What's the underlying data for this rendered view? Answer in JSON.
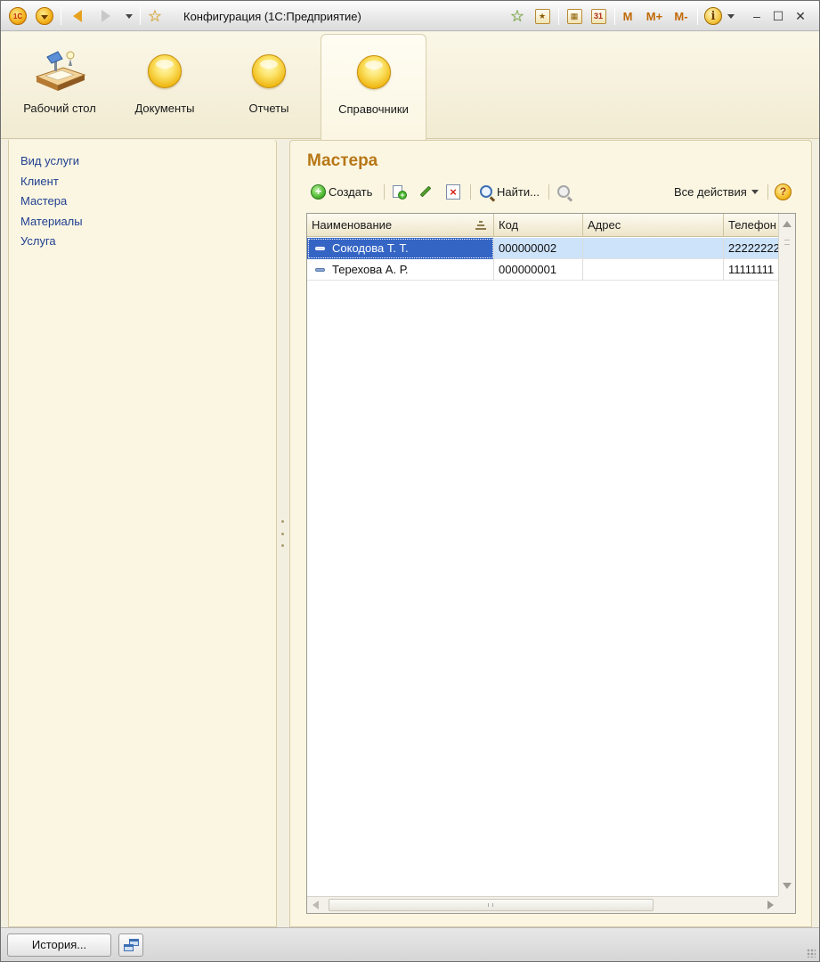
{
  "titlebar": {
    "logo_text": "1С",
    "title": "Конфигурация  (1С:Предприятие)",
    "calendar_day": "31",
    "mem_m": "M",
    "mem_mplus": "M+",
    "mem_mminus": "M-",
    "info": "i",
    "minimize": "–",
    "maximize": "☐",
    "close": "✕"
  },
  "sections": [
    {
      "label": "Рабочий стол",
      "icon": "desktop-icon"
    },
    {
      "label": "Документы",
      "icon": "section-ball-icon"
    },
    {
      "label": "Отчеты",
      "icon": "section-ball-icon"
    },
    {
      "label": "Справочники",
      "icon": "section-ball-icon",
      "active": true
    }
  ],
  "nav": {
    "items": [
      "Вид услуги",
      "Клиент",
      "Мастера",
      "Материалы",
      "Услуга"
    ]
  },
  "form": {
    "title": "Мастера",
    "toolbar": {
      "create_label": "Создать",
      "find_label": "Найти...",
      "all_actions_label": "Все действия",
      "help": "?"
    },
    "table": {
      "columns": [
        "Наименование",
        "Код",
        "Адрес",
        "Телефон"
      ],
      "rows": [
        {
          "name": "Сокодова Т. Т.",
          "code": "000000002",
          "address": "",
          "phone": "22222222"
        },
        {
          "name": "Терехова А. Р.",
          "code": "000000001",
          "address": "",
          "phone": "11111111"
        }
      ],
      "selected_row": 0
    }
  },
  "statusbar": {
    "history_label": "История..."
  },
  "colors": {
    "accent_title": "#b77716",
    "nav_link": "#1f3f8f",
    "selection": "#3565c4"
  }
}
